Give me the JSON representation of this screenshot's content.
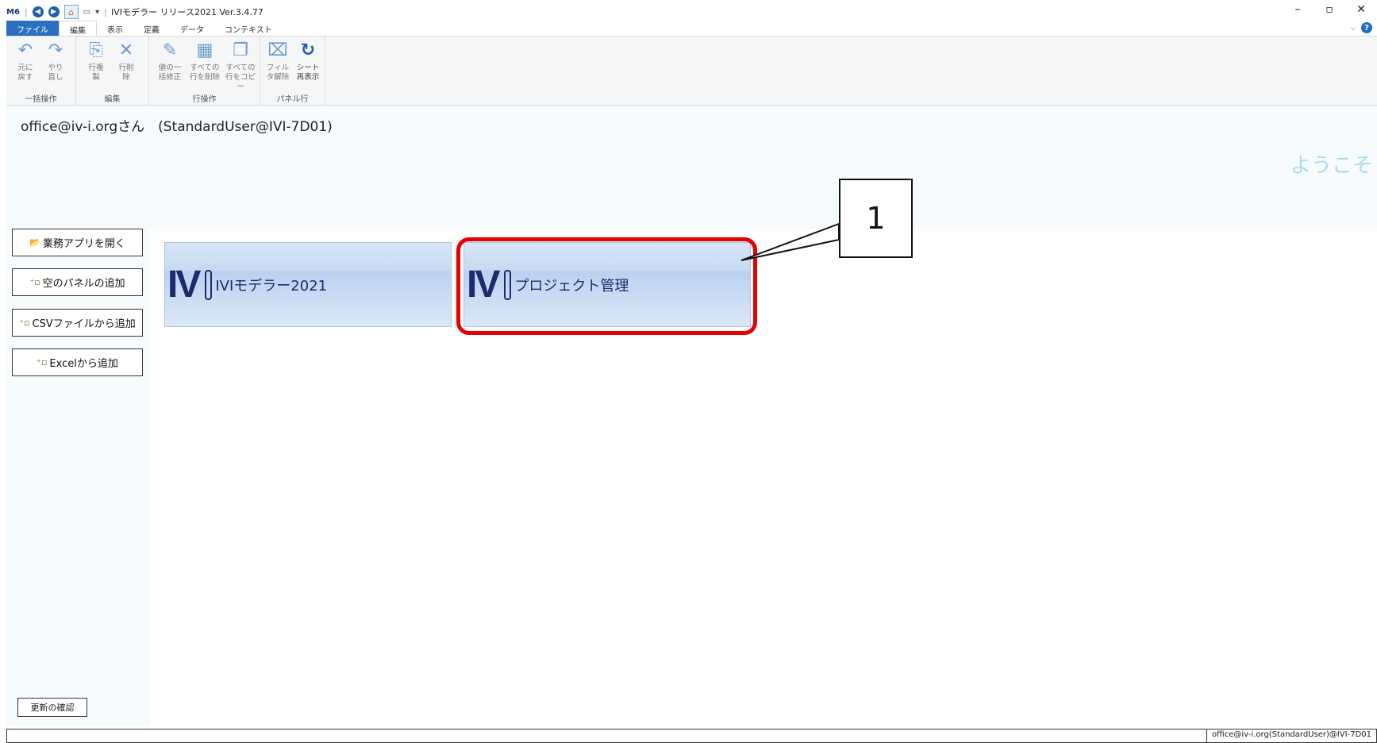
{
  "titlebar": {
    "title": "IVIモデラー リリース2021 Ver.3.4.77",
    "app_logo": "M6",
    "minimize": "–",
    "restore": "▫",
    "close": "✕"
  },
  "menu_tabs": [
    {
      "label": "ファイル"
    },
    {
      "label": "編集"
    },
    {
      "label": "表示"
    },
    {
      "label": "定義"
    },
    {
      "label": "データ"
    },
    {
      "label": "コンテキスト"
    }
  ],
  "ribbon": {
    "groups": [
      {
        "label": "一括操作",
        "buttons": [
          {
            "line1": "元に",
            "line2": "戻す",
            "icon": "undo-icon",
            "glyph": "↶"
          },
          {
            "line1": "やり",
            "line2": "直し",
            "icon": "redo-icon",
            "glyph": "↷"
          }
        ]
      },
      {
        "label": "編集",
        "buttons": [
          {
            "line1": "行複",
            "line2": "製",
            "icon": "copy-row-icon",
            "glyph": "⎘"
          },
          {
            "line1": "行削",
            "line2": "除",
            "icon": "delete-row-icon",
            "glyph": "✕"
          }
        ]
      },
      {
        "label": "行操作",
        "buttons": [
          {
            "line1": "値の一",
            "line2": "括修正",
            "icon": "bulk-edit-icon",
            "glyph": "✎"
          },
          {
            "line1": "すべての",
            "line2": "行を削除",
            "icon": "delete-all-rows-icon",
            "glyph": "▦"
          },
          {
            "line1": "すべての",
            "line2": "行をコピー",
            "icon": "copy-all-rows-icon",
            "glyph": "❐"
          }
        ]
      },
      {
        "label": "パネル行",
        "buttons": [
          {
            "line1": "フィル",
            "line2": "タ解除",
            "icon": "clear-filter-icon",
            "glyph": "⌧"
          },
          {
            "line1": "シート",
            "line2": "再表示",
            "icon": "refresh-icon",
            "glyph": "↻"
          }
        ]
      }
    ]
  },
  "user": {
    "line": "office@iv-i.orgさん　(StandardUser@IVI-7D01)",
    "welcome": "ようこそ"
  },
  "left_buttons": [
    {
      "label": "業務アプリを開く",
      "icon": "open-app-icon",
      "glyph": "📂"
    },
    {
      "label": "空のパネルの追加",
      "icon": "add-panel-icon",
      "glyph": "⁺▫"
    },
    {
      "label": "CSVファイルから追加",
      "icon": "add-csv-icon",
      "glyph": "⁺▫"
    },
    {
      "label": "Excelから追加",
      "icon": "add-excel-icon",
      "glyph": "⁺▫"
    }
  ],
  "update_button": "更新の確認",
  "tiles": [
    {
      "logo": "IV",
      "label": "IVIモデラー2021"
    },
    {
      "logo": "IV",
      "label": "プロジェクト管理"
    }
  ],
  "callout": {
    "number": "1"
  },
  "status": {
    "right": "office@iv-i.org(StandardUser)@IVI-7D01"
  },
  "help": {
    "chevron": "⌵",
    "icon": "?"
  },
  "colors": {
    "highlight": "#e60000",
    "tile_text": "#1f2a6e",
    "file_tab": "#2b6fc1",
    "welcome": "#a9dbf0"
  }
}
